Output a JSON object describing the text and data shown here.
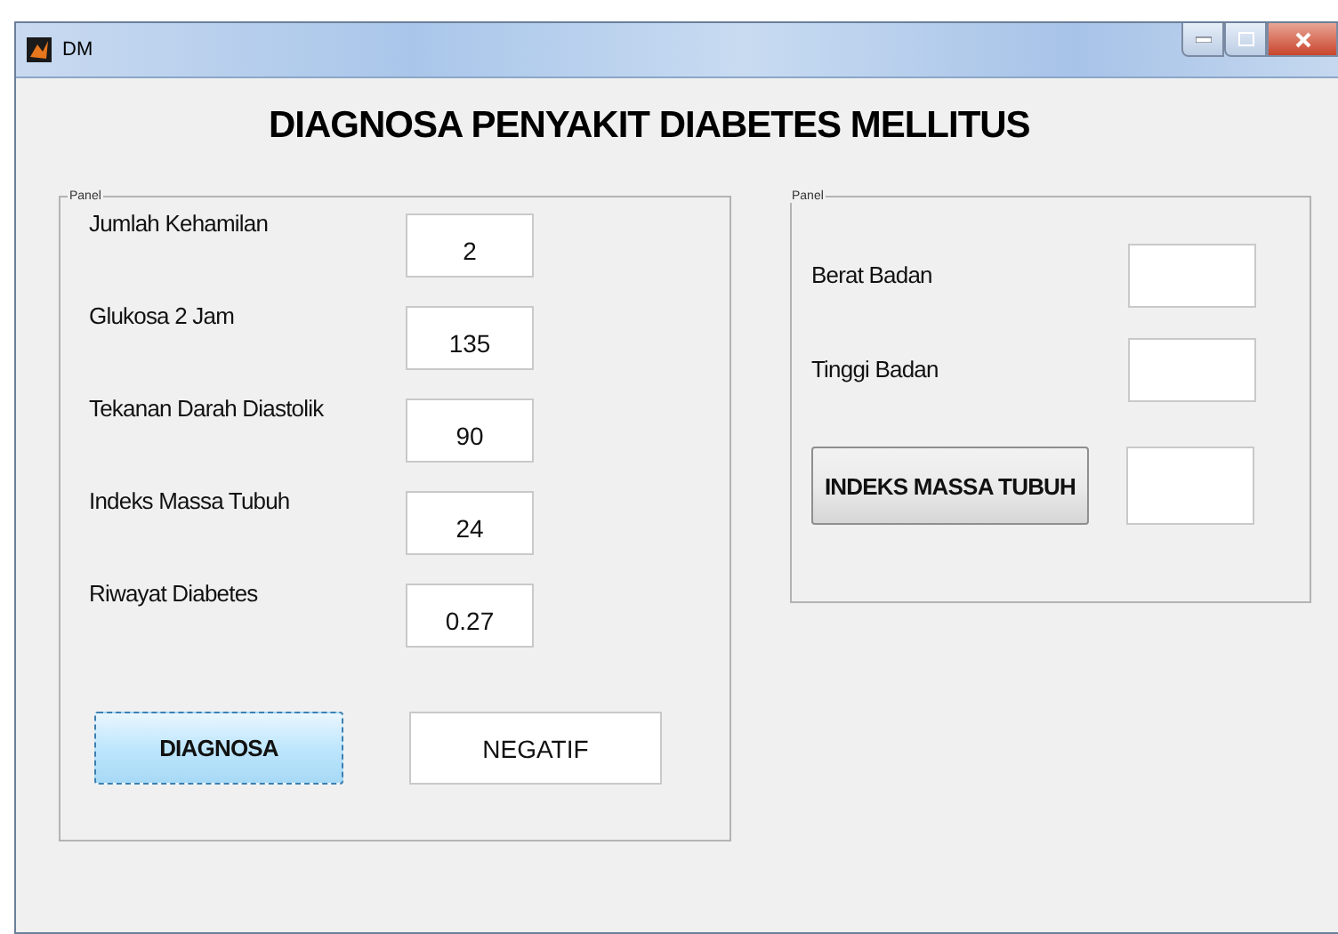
{
  "window": {
    "title": "DM"
  },
  "heading": "DIAGNOSA PENYAKIT DIABETES MELLITUS",
  "left_panel": {
    "legend": "Panel",
    "fields": [
      {
        "label": "Jumlah Kehamilan",
        "value": "2"
      },
      {
        "label": "Glukosa 2 Jam",
        "value": "135"
      },
      {
        "label": "Tekanan Darah Diastolik",
        "value": "90"
      },
      {
        "label": "Indeks Massa Tubuh",
        "value": "24"
      },
      {
        "label": "Riwayat Diabetes",
        "value": "0.27"
      }
    ],
    "button": {
      "label": "DIAGNOSA",
      "focused": true
    },
    "result": "NEGATIF"
  },
  "right_panel": {
    "legend": "Panel",
    "fields": [
      {
        "label": "Berat Badan"
      },
      {
        "label": "Tinggi Badan"
      }
    ],
    "button": {
      "label": "INDEKS MASSA TUBUH",
      "focused": false
    }
  }
}
